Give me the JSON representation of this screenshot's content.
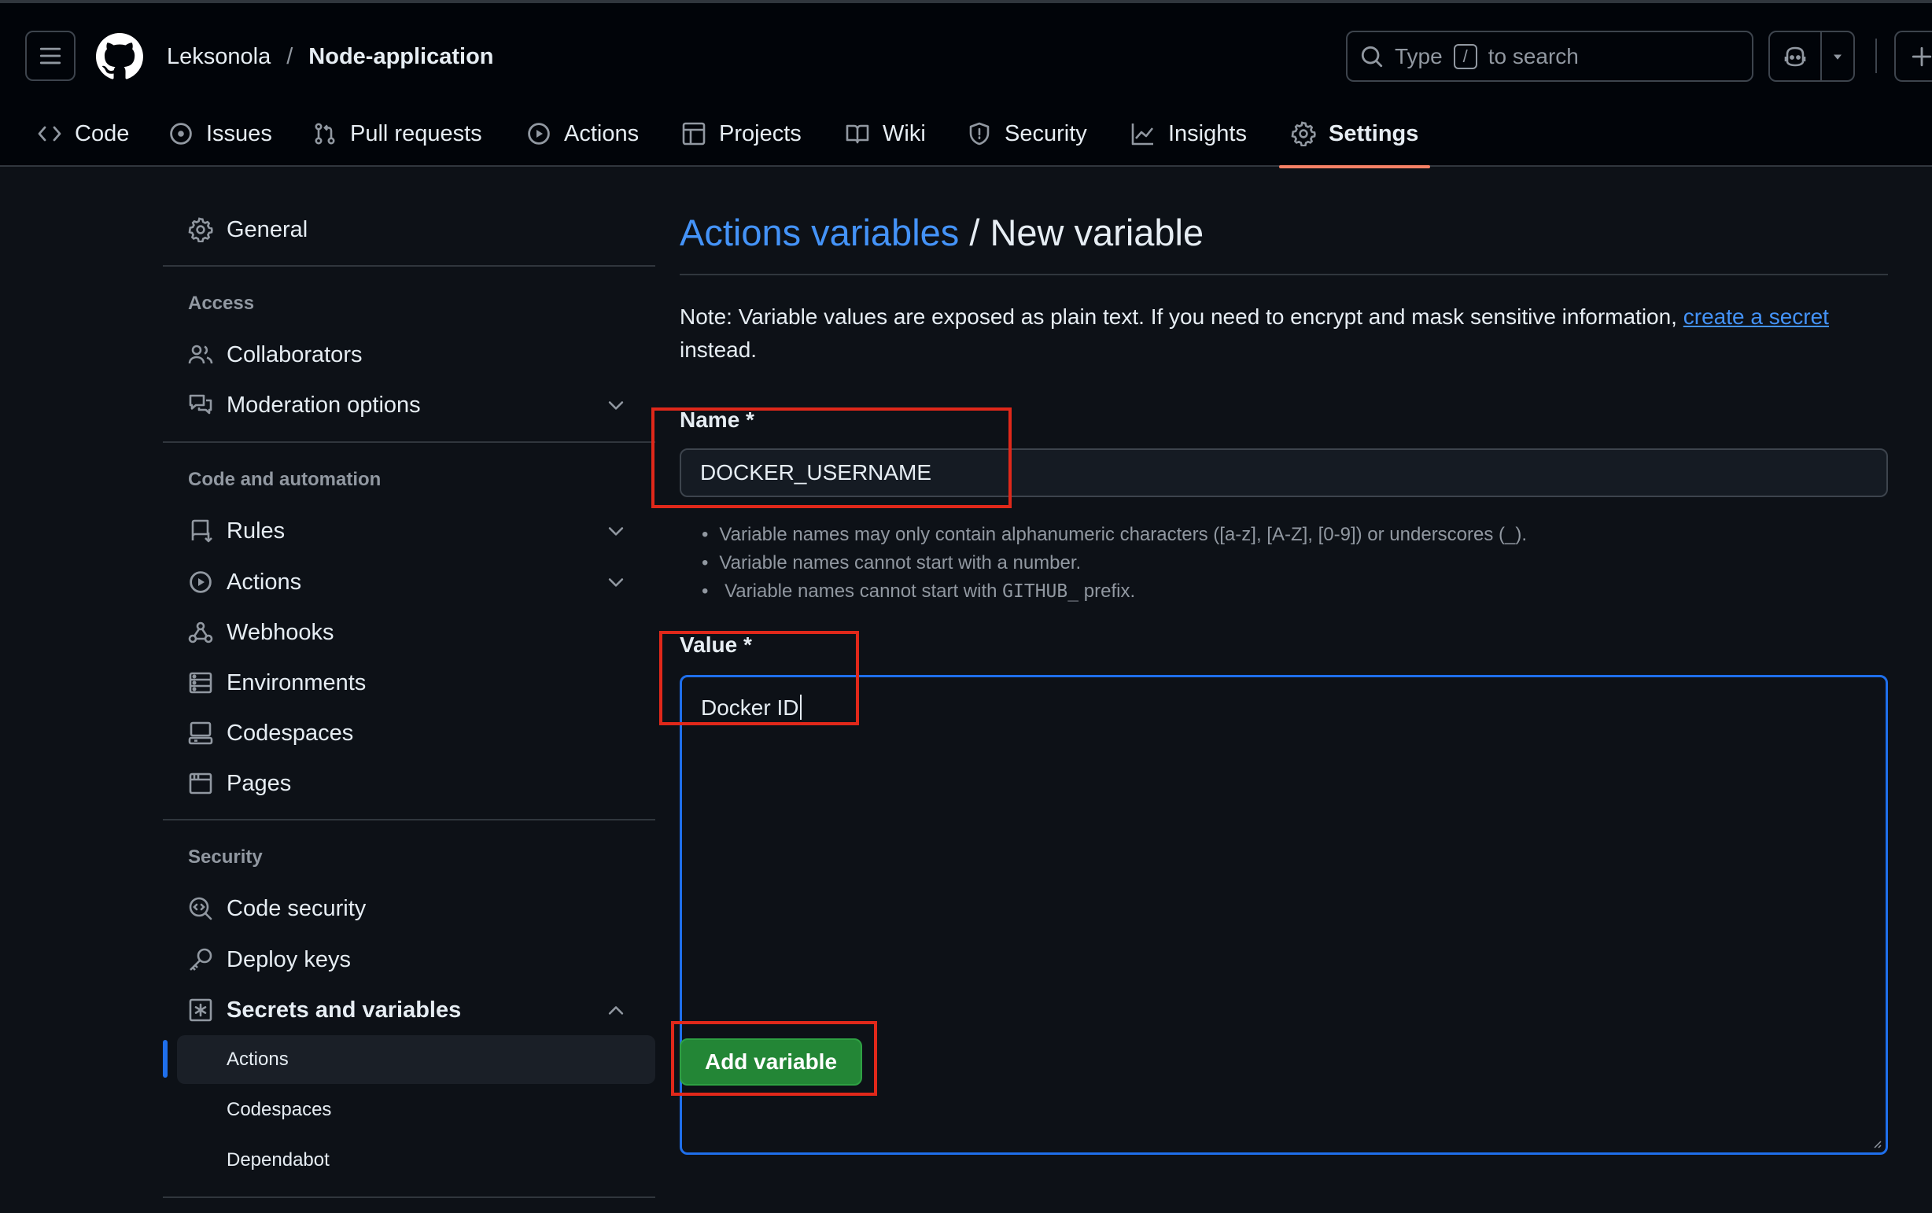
{
  "header": {
    "owner": "Leksonola",
    "separator": "/",
    "repo": "Node-application",
    "search": {
      "prefix": "Type",
      "key": "/",
      "suffix": "to search"
    }
  },
  "tabs": [
    {
      "label": "Code",
      "icon": "code-icon"
    },
    {
      "label": "Issues",
      "icon": "issue-icon"
    },
    {
      "label": "Pull requests",
      "icon": "pull-request-icon"
    },
    {
      "label": "Actions",
      "icon": "play-icon"
    },
    {
      "label": "Projects",
      "icon": "table-icon"
    },
    {
      "label": "Wiki",
      "icon": "book-icon"
    },
    {
      "label": "Security",
      "icon": "shield-icon"
    },
    {
      "label": "Insights",
      "icon": "graph-icon"
    },
    {
      "label": "Settings",
      "icon": "gear-icon",
      "active": true
    }
  ],
  "sidebar": {
    "general": "General",
    "access_heading": "Access",
    "collaborators": "Collaborators",
    "moderation": "Moderation options",
    "code_heading": "Code and automation",
    "rules": "Rules",
    "actions": "Actions",
    "webhooks": "Webhooks",
    "environments": "Environments",
    "codespaces": "Codespaces",
    "pages": "Pages",
    "security_heading": "Security",
    "code_security": "Code security",
    "deploy_keys": "Deploy keys",
    "secrets": "Secrets and variables",
    "sub_actions": "Actions",
    "sub_codespaces": "Codespaces",
    "sub_dependabot": "Dependabot"
  },
  "main": {
    "title_link": "Actions variables",
    "title_rest": "/ New variable",
    "note_text": "Note: Variable values are exposed as plain text. If you need to encrypt and mask sensitive information,",
    "note_link": "create a secret",
    "note_end": "instead.",
    "name_label": "Name *",
    "name_value": "DOCKER_USERNAME",
    "hint1": "Variable names may only contain alphanumeric characters ([a-z], [A-Z], [0-9]) or underscores (_).",
    "hint2": "Variable names cannot start with a number.",
    "hint3_a": "Variable names cannot start with",
    "hint3_code": "GITHUB_",
    "hint3_b": "prefix.",
    "value_label": "Value *",
    "value_value": "Docker ID",
    "add_button": "Add variable"
  },
  "colors": {
    "background": "#0d1117",
    "accent_link": "#4493f8",
    "active_tab_underline": "#f78166",
    "button_green": "#238636",
    "annotation_red": "#e0281a",
    "focus_blue": "#1f6feb"
  }
}
